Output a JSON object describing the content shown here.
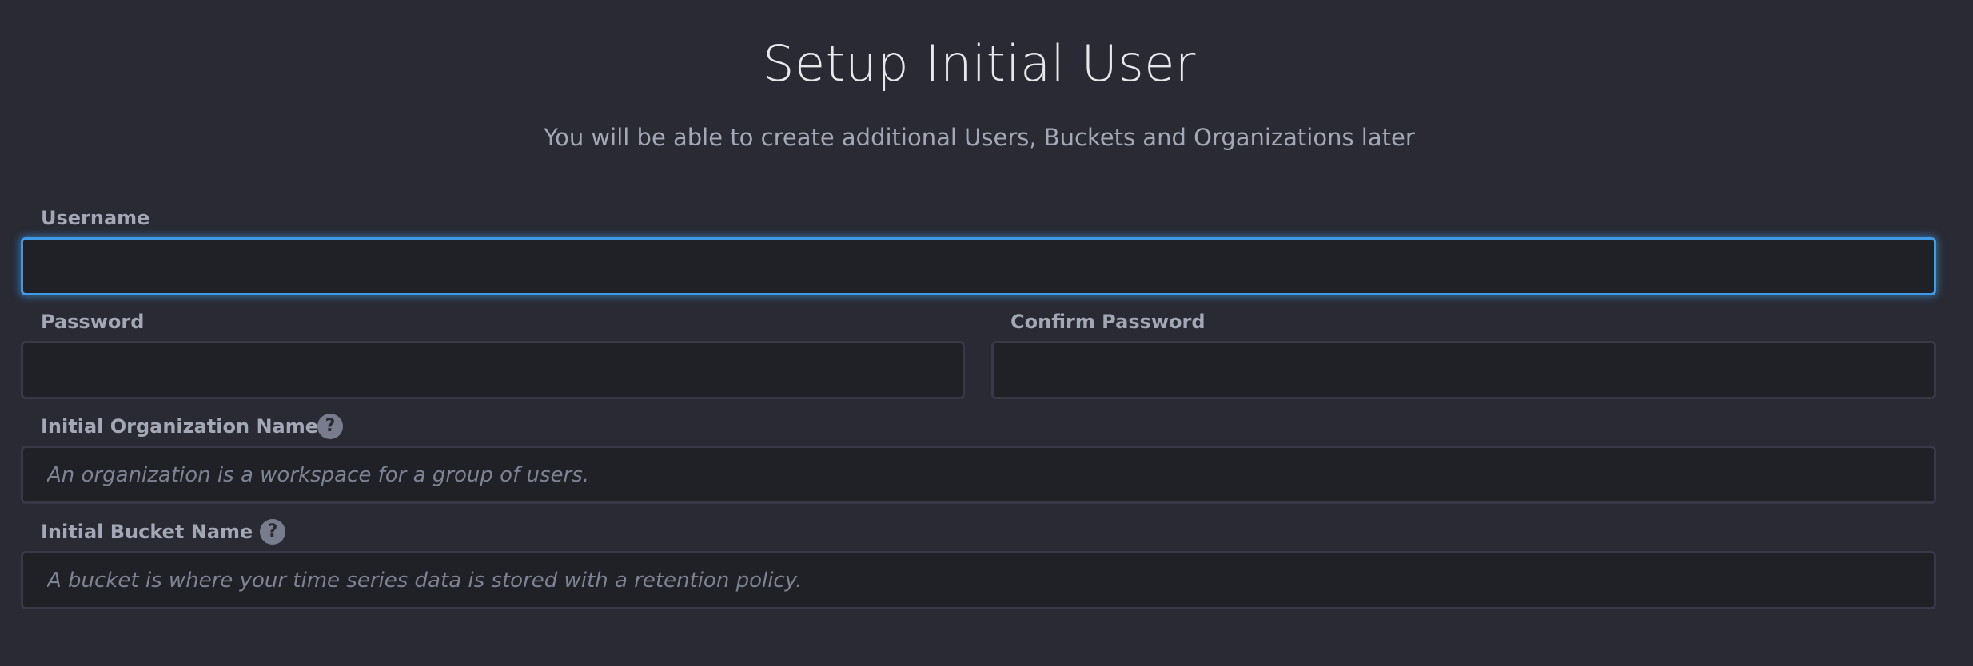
{
  "page": {
    "title": "Setup Initial User",
    "subtitle": "You will be able to create additional Users, Buckets and Organizations later"
  },
  "form": {
    "username": {
      "label": "Username",
      "value": "",
      "placeholder": ""
    },
    "password": {
      "label": "Password",
      "value": "",
      "placeholder": ""
    },
    "confirm_password": {
      "label": "Confirm Password",
      "value": "",
      "placeholder": ""
    },
    "organization": {
      "label": "Initial Organization Name",
      "value": "",
      "placeholder": "An organization is a workspace for a group of users.",
      "help_icon": "question-circle-icon"
    },
    "bucket": {
      "label": "Initial Bucket Name",
      "value": "",
      "placeholder": "A bucket is where your time series data is stored with a retention policy.",
      "help_icon": "question-circle-icon"
    }
  },
  "colors": {
    "background": "#292a33",
    "input_background": "#202127",
    "input_border": "#383846",
    "focus_accent": "#3f9be8",
    "label_text": "#a4a8b6",
    "title_text": "#e7e8eb"
  }
}
